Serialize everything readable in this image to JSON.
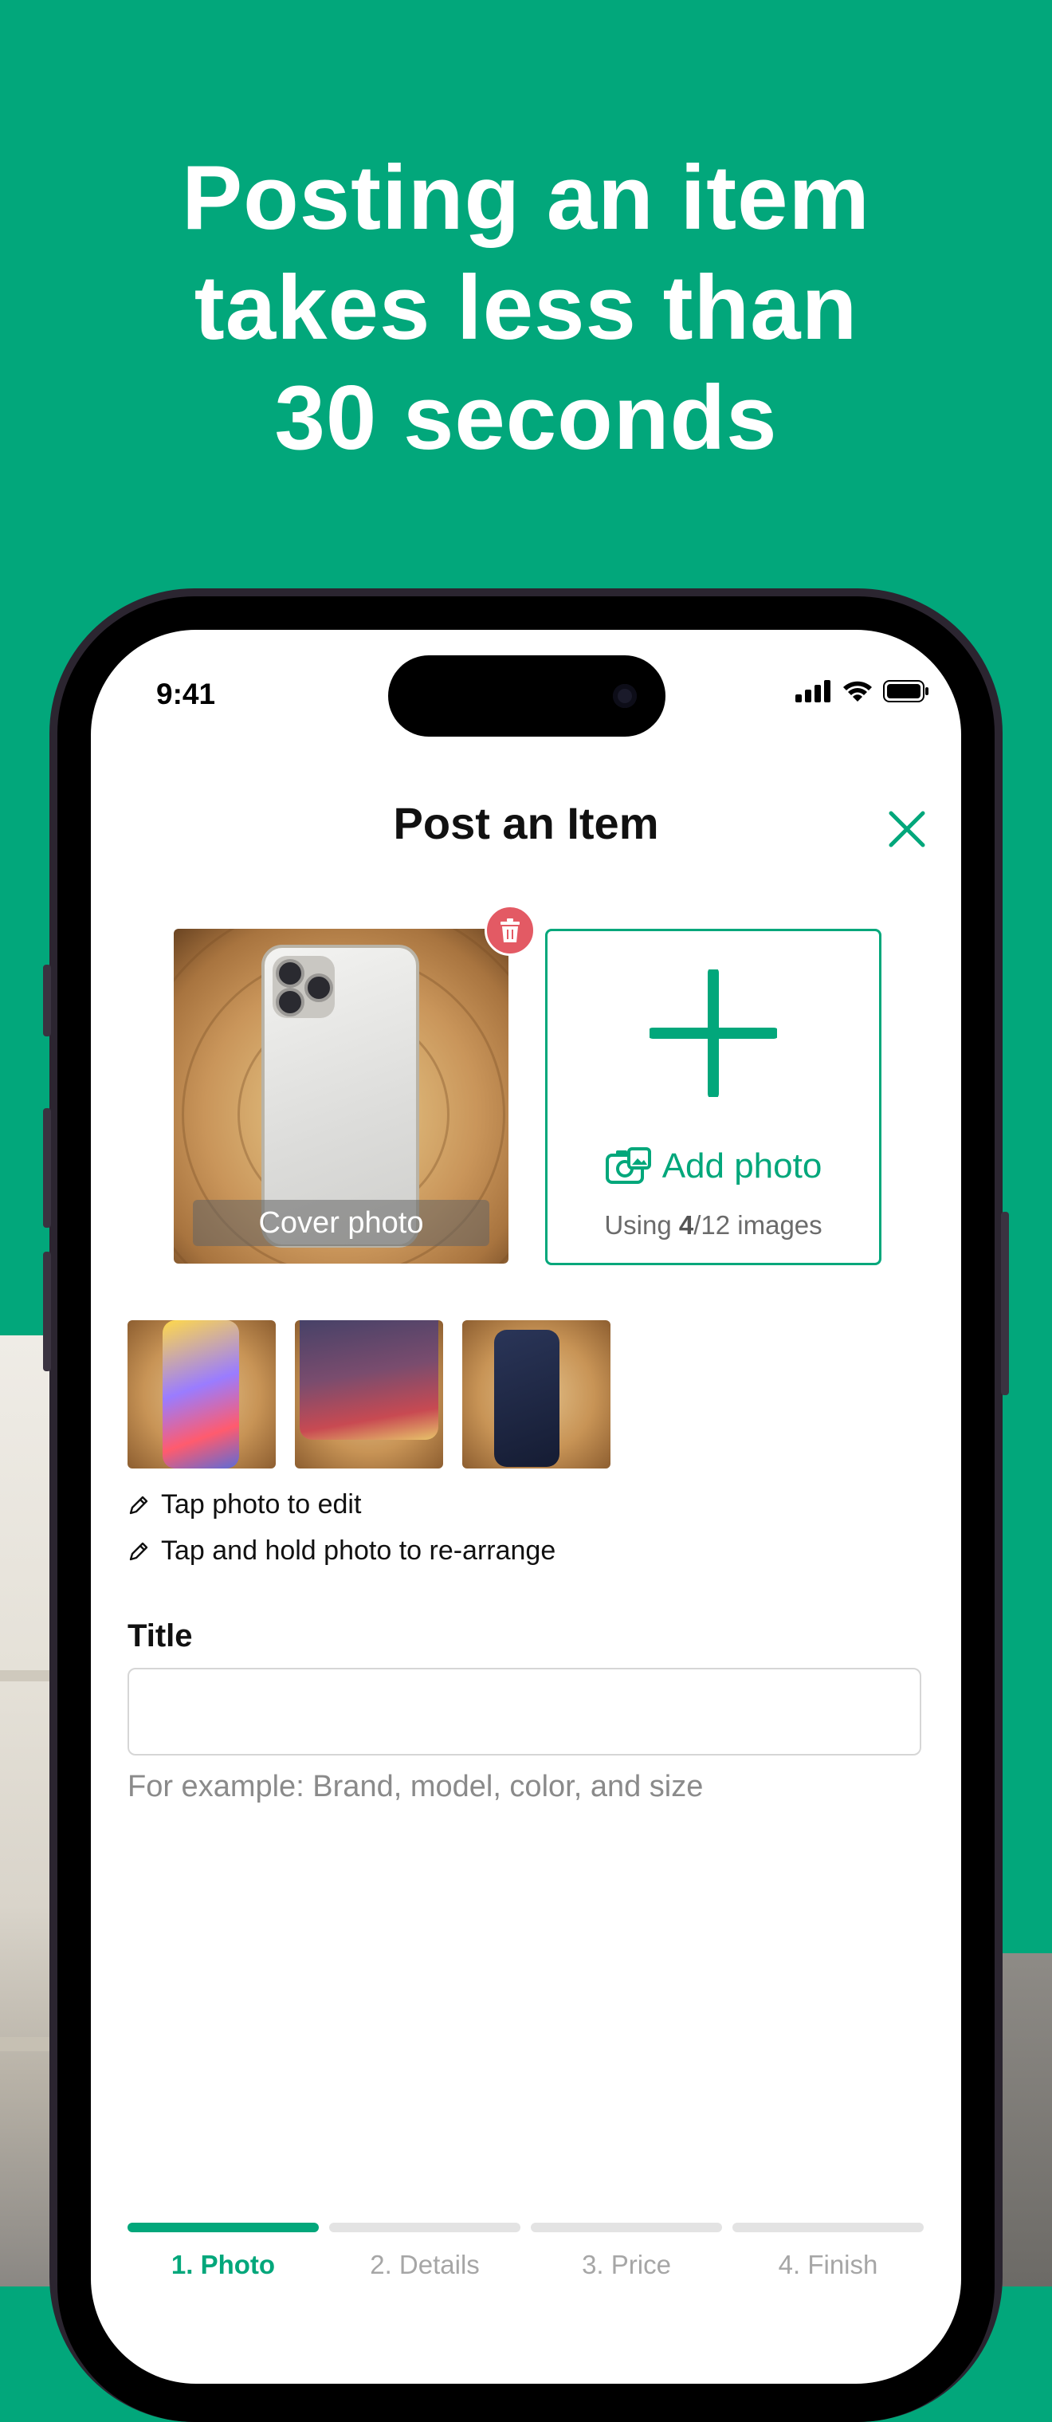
{
  "headline": {
    "line1": "Posting an item",
    "line2": "takes less than",
    "line3": "30 seconds"
  },
  "status_bar": {
    "time": "9:41",
    "icons": [
      "cellular-signal-icon",
      "wifi-icon",
      "battery-icon"
    ]
  },
  "nav": {
    "title": "Post an Item",
    "close_icon": "close-icon"
  },
  "photos": {
    "cover_label": "Cover photo",
    "delete_icon": "trash-icon",
    "add_label": "Add photo",
    "add_icon": "camera-photo-icon",
    "usage_prefix": "Using ",
    "usage_count": "4",
    "usage_suffix": "/12 images"
  },
  "hints": [
    {
      "icon": "pencil-icon",
      "text": "Tap photo to edit"
    },
    {
      "icon": "pencil-icon",
      "text": "Tap and hold photo to re-arrange"
    }
  ],
  "form": {
    "title_label": "Title",
    "title_value": "",
    "title_helper": "For example: Brand, model, color, and size"
  },
  "steps": [
    {
      "label": "1. Photo",
      "active": true
    },
    {
      "label": "2. Details",
      "active": false
    },
    {
      "label": "3. Price",
      "active": false
    },
    {
      "label": "4. Finish",
      "active": false
    }
  ],
  "colors": {
    "brand_green": "#02a77b",
    "delete_red": "#e35a64",
    "inactive_gray": "#a6a6a6"
  }
}
